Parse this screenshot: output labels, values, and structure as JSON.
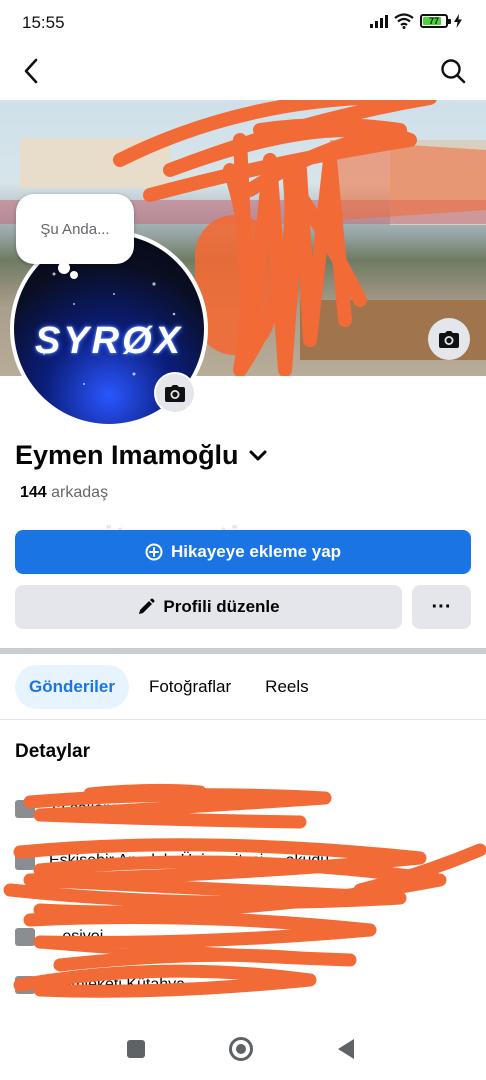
{
  "status_bar": {
    "time": "15:55",
    "battery_label": "77",
    "icons": [
      "signal-icon",
      "wifi-icon",
      "battery-icon",
      "charging-icon"
    ]
  },
  "top_bar": {
    "icons": [
      "back-arrow-icon",
      "search-icon"
    ]
  },
  "cover": {
    "icons": [
      "camera-icon"
    ]
  },
  "profile_picture": {
    "text": "SYRØX"
  },
  "note_bubble": {
    "text": "Şu Anda..."
  },
  "profile": {
    "name": "Eymen Imamoğlu",
    "friend_count": "144",
    "friend_label": "arkadaş"
  },
  "watermark": {
    "text": "itemsatis"
  },
  "actions": {
    "add_story_label": "Hikayeye ekleme yap",
    "edit_profile_label": "Profili düzenle",
    "more_label": "···"
  },
  "tabs": [
    {
      "label": "Gönderiler",
      "active": true
    },
    {
      "label": "Fotoğraflar",
      "active": false
    },
    {
      "label": "Reels",
      "active": false
    }
  ],
  "details": {
    "title": "Detaylar",
    "rows": [
      {
        "icon": "briefcase-icon",
        "text": "'ta çalışıyor"
      },
      {
        "icon": "graduation-cap-icon",
        "text": "Eskişehir Anadolu Üniversitesi ... okudu"
      },
      {
        "icon": "school-icon",
        "text": "...esivoi"
      },
      {
        "icon": "location-icon",
        "text": "Memleketi Kütahya"
      }
    ]
  },
  "colors": {
    "accent": "#1b74e4",
    "active_tab_bg": "#e7f3ff",
    "secondary_button_bg": "#e4e6eb",
    "redaction_orange": "#f26a35"
  },
  "nav_bar": {
    "icons": [
      "recent-apps-icon",
      "home-icon",
      "back-triangle-icon"
    ]
  }
}
